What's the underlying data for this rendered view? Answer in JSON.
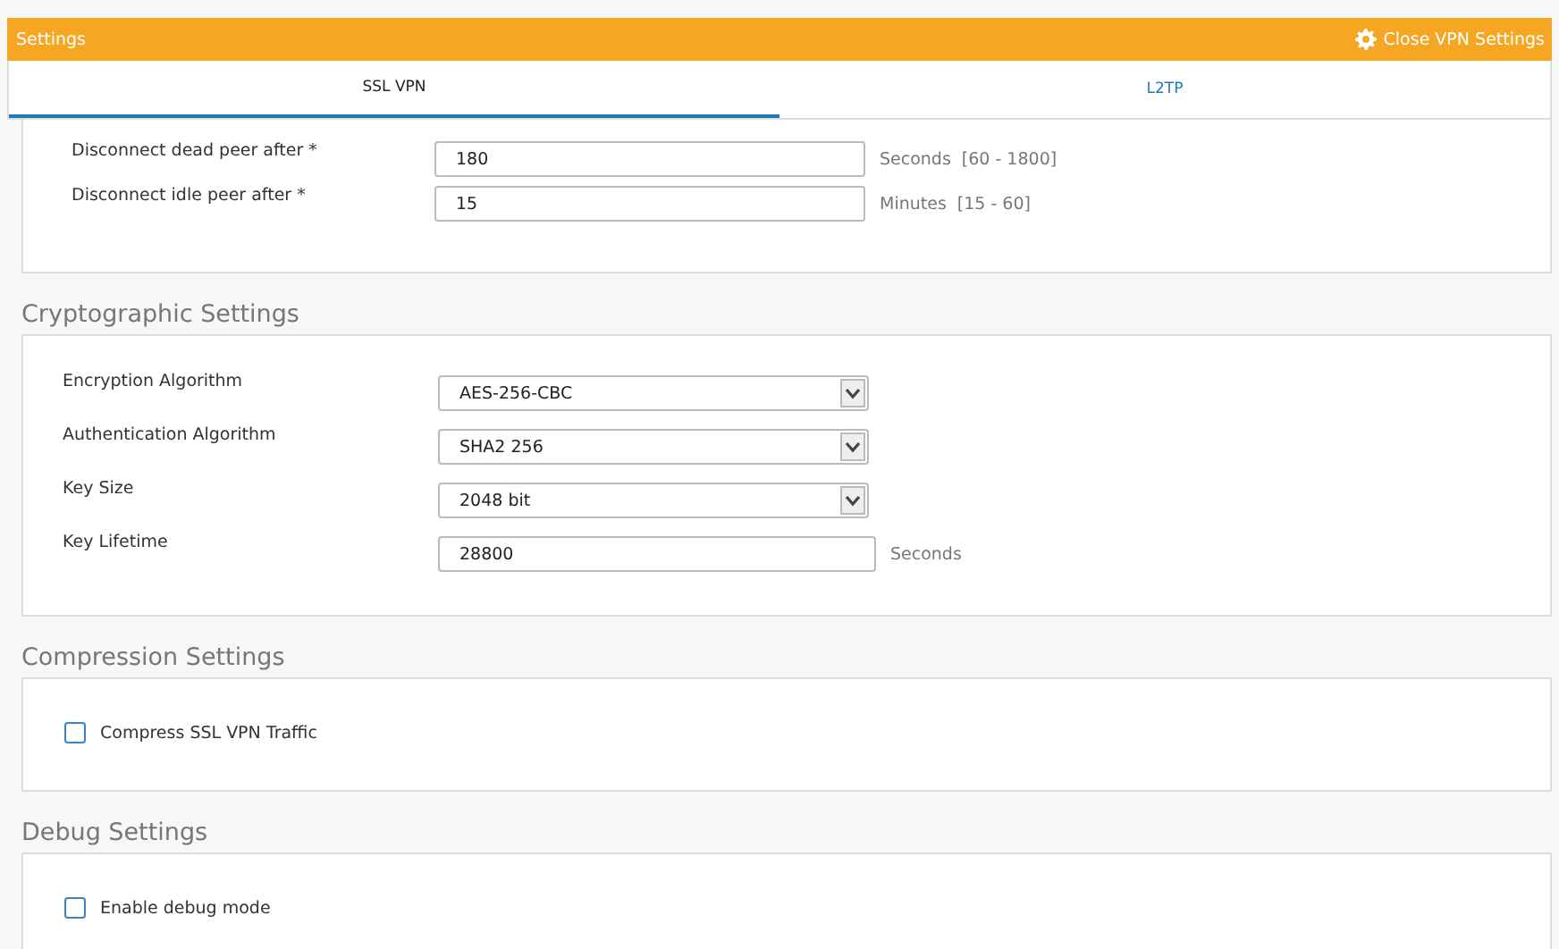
{
  "header": {
    "title": "Settings",
    "close_label": "Close VPN Settings"
  },
  "tabs": [
    {
      "label": "SSL VPN",
      "selected": true
    },
    {
      "label": "L2TP",
      "selected": false
    }
  ],
  "panels": [
    {
      "rows": [
        {
          "kind": "input",
          "label": "Disconnect dead peer after *",
          "value": "180",
          "unit": "Seconds",
          "range": "[60 - 1800]"
        },
        {
          "kind": "input",
          "label": "Disconnect idle peer after *",
          "value": "15",
          "unit": "Minutes",
          "range": "[15 - 60]"
        }
      ]
    },
    {
      "title": "Cryptographic Settings",
      "rows": [
        {
          "kind": "select",
          "label": "Encryption Algorithm",
          "value": "AES-256-CBC"
        },
        {
          "kind": "select",
          "label": "Authentication Algorithm",
          "value": "SHA2 256"
        },
        {
          "kind": "select",
          "label": "Key Size",
          "value": "2048 bit"
        },
        {
          "kind": "input",
          "label": "Key Lifetime",
          "value": "28800",
          "unit": "Seconds"
        }
      ]
    },
    {
      "title": "Compression Settings",
      "rows": [
        {
          "kind": "checkbox",
          "label": "Compress SSL VPN Traffic",
          "checked": false
        }
      ]
    },
    {
      "title": "Debug Settings",
      "rows": [
        {
          "kind": "checkbox",
          "label": "Enable debug mode",
          "checked": false
        }
      ]
    }
  ]
}
